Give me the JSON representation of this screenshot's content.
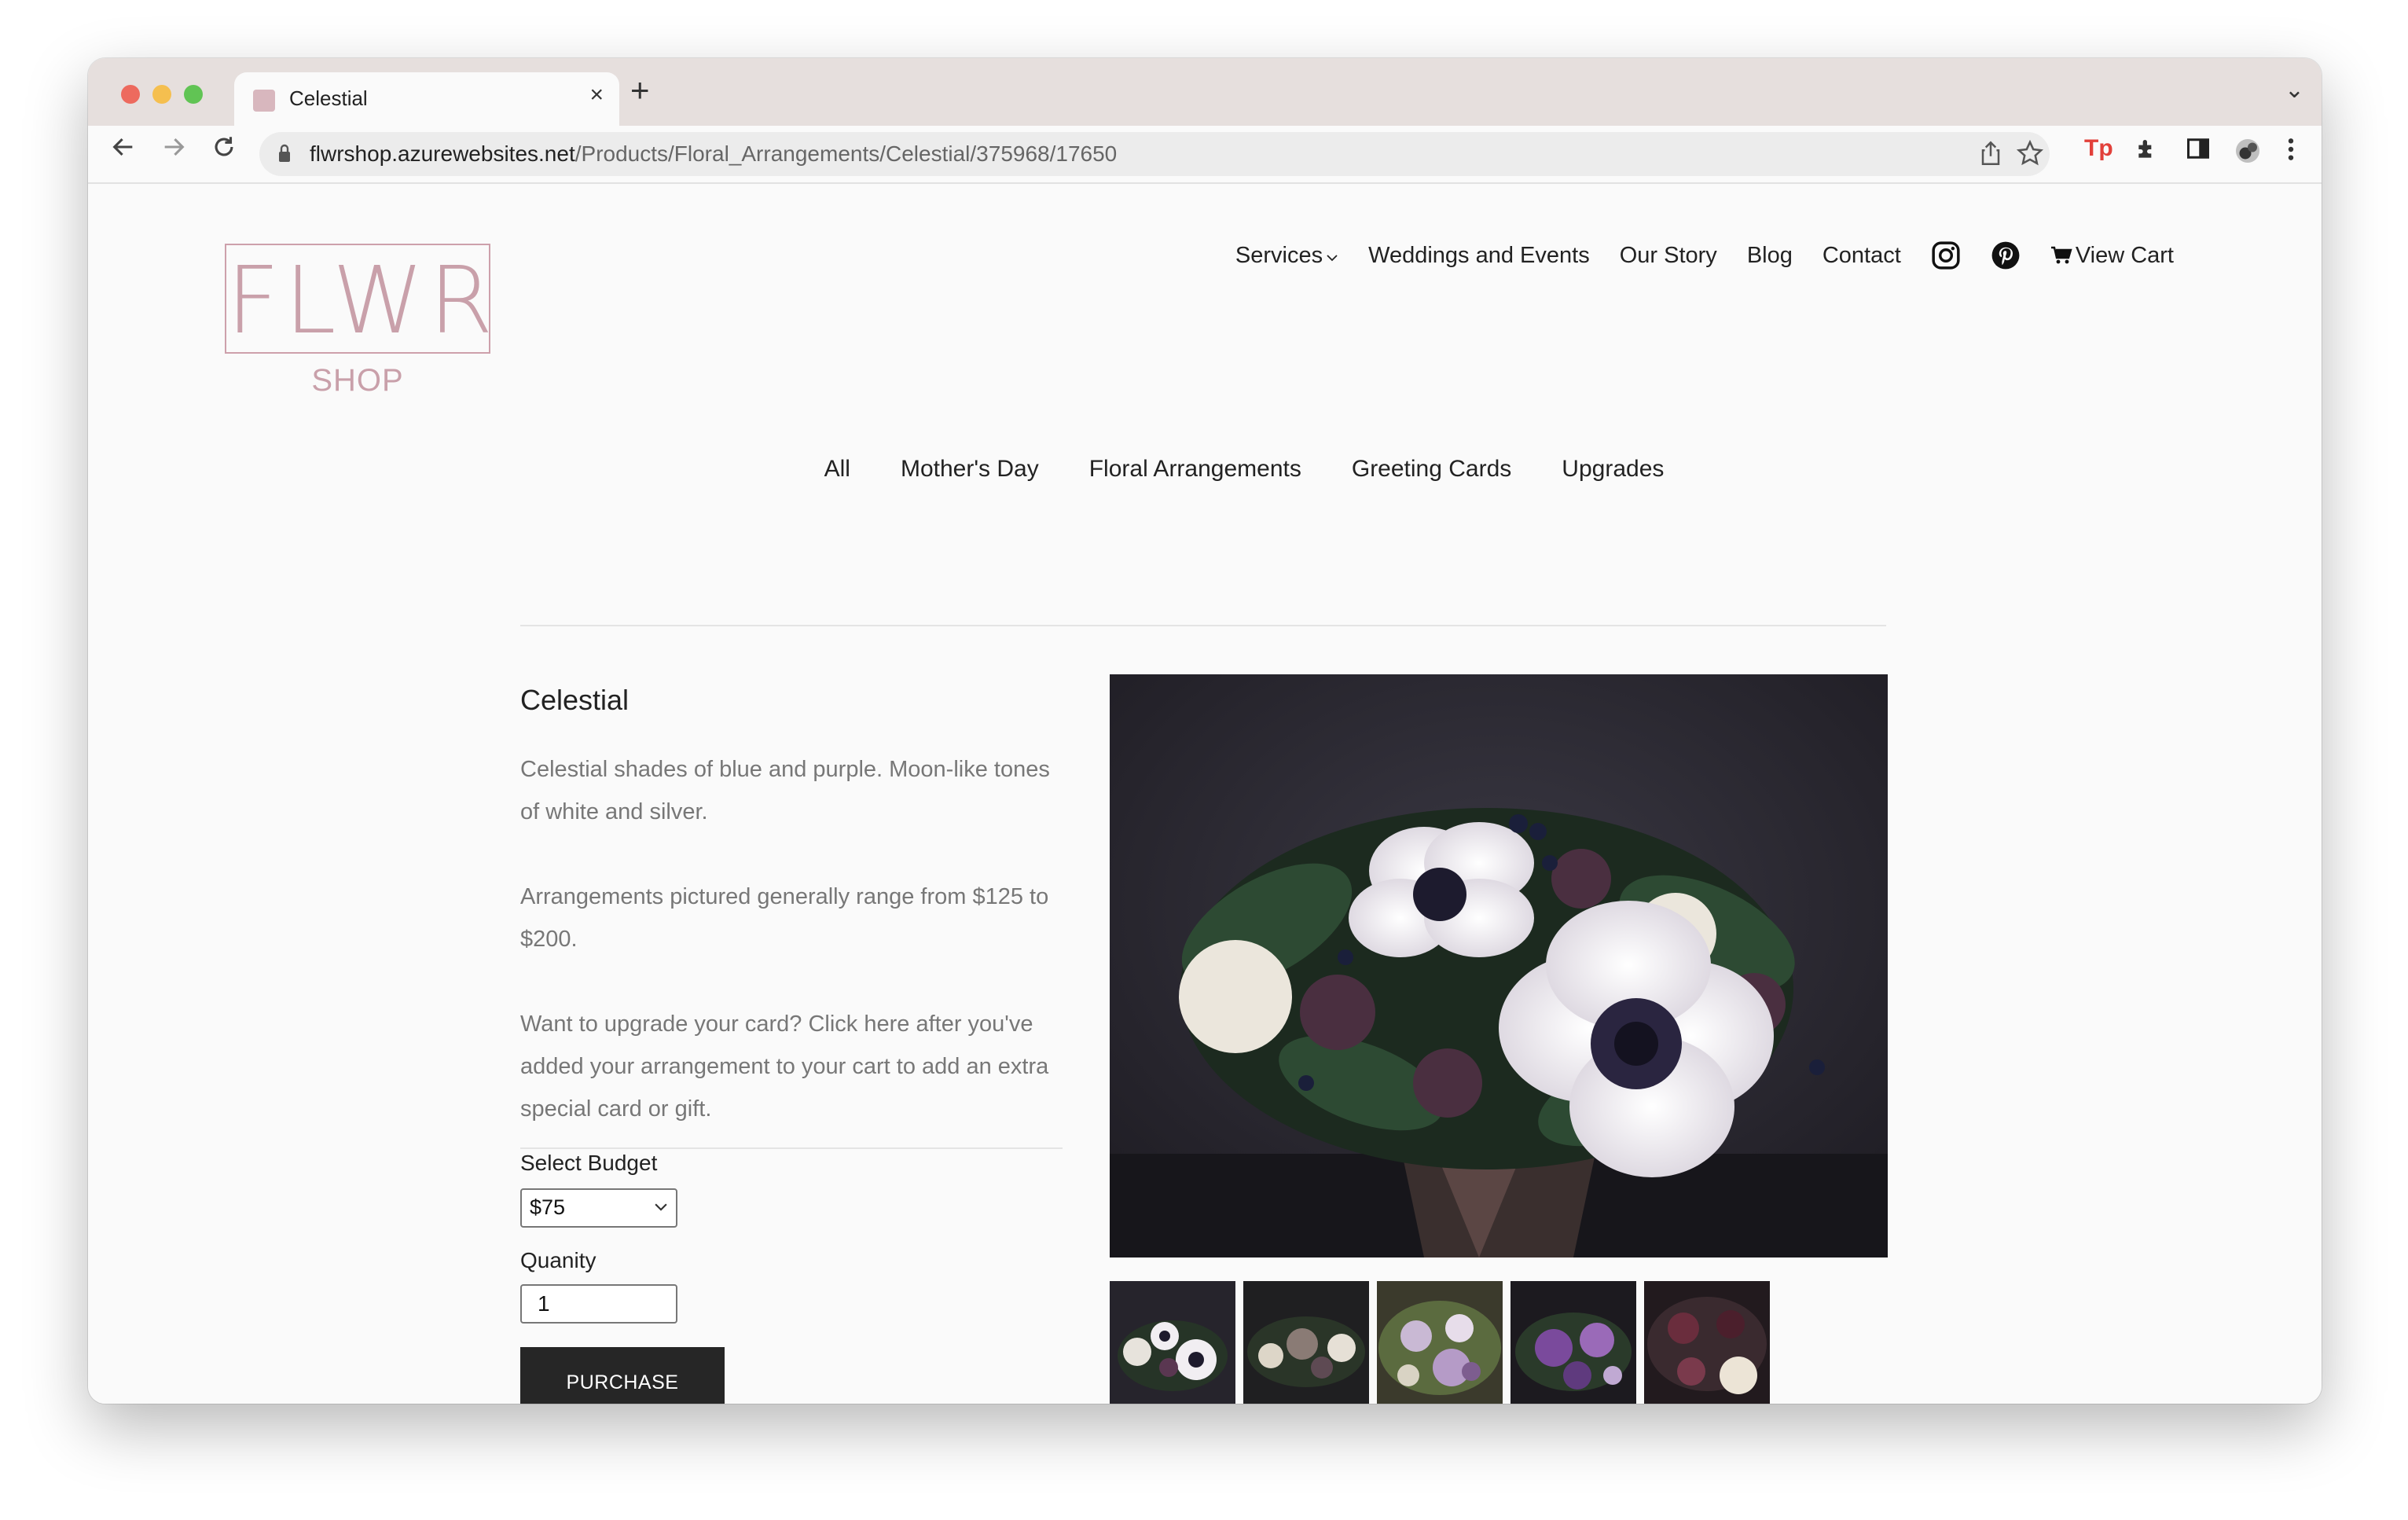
{
  "browser": {
    "tab_title": "Celestial",
    "tab_close": "×",
    "new_tab": "+",
    "tab_menu": "⌄",
    "url_host": "flwrshop.azurewebsites.net",
    "url_path": "/Products/Floral_Arrangements/Celestial/375968/17650"
  },
  "site": {
    "logo_main": "FLWR",
    "logo_sub": "SHOP",
    "brand_color": "#c9a0aa"
  },
  "topnav": {
    "services": "Services",
    "weddings": "Weddings and Events",
    "our_story": "Our Story",
    "blog": "Blog",
    "contact": "Contact",
    "view_cart": "View Cart"
  },
  "categories": [
    "All",
    "Mother's  Day",
    "Floral Arrangements",
    "Greeting Cards",
    "Upgrades"
  ],
  "product": {
    "title": "Celestial",
    "desc1": "Celestial shades of blue and purple.  Moon-like tones of white and silver.",
    "desc2": "Arrangements pictured generally range from $125 to $200.",
    "desc3": "Want to upgrade your card? Click here after you've added your arrangement to your cart to add an extra special card or gift.",
    "budget_label": "Select  Budget",
    "budget_value": "$75",
    "quantity_label": "Quanity",
    "quantity_value": "1",
    "purchase_label": "PURCHASE"
  }
}
